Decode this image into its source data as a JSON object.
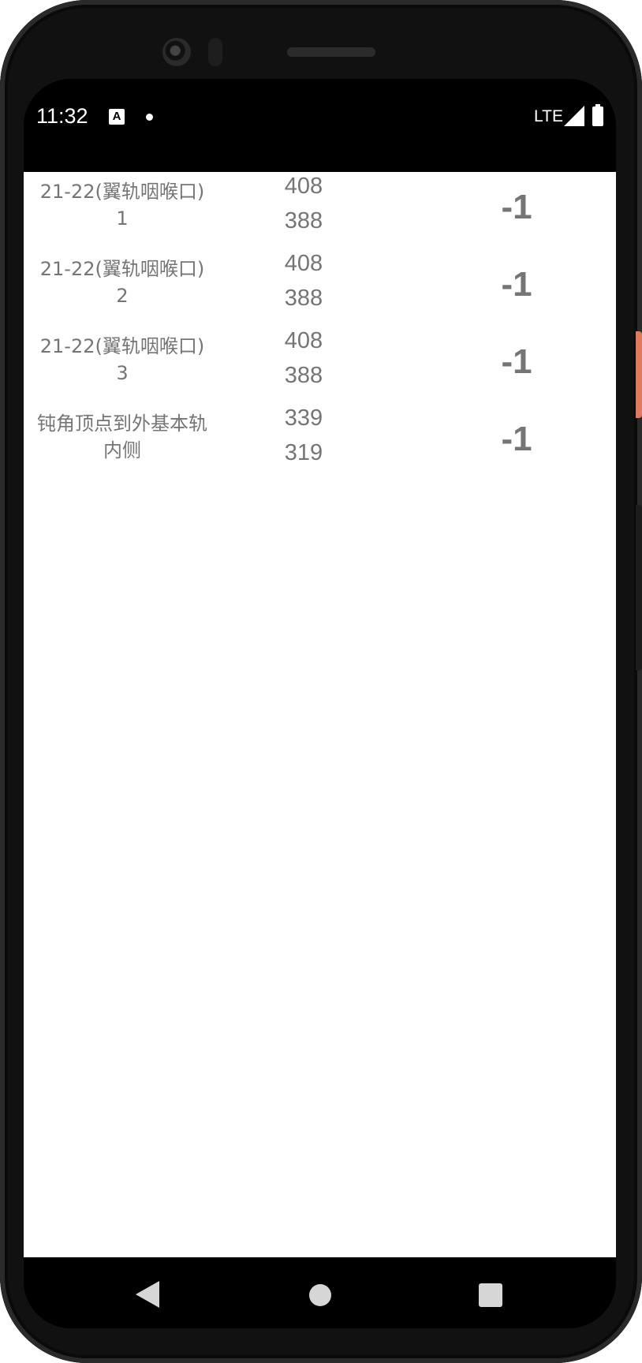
{
  "status_bar": {
    "time": "11:32",
    "notification_icon": "a-notification-icon",
    "network": "LTE",
    "signal_icon": "signal-icon",
    "battery_icon": "battery-icon"
  },
  "rows": [
    {
      "label_line1": "21-22(翼轨咽喉口)",
      "label_line2": "1",
      "value_top": "408",
      "value_bottom": "388",
      "difference": "-1"
    },
    {
      "label_line1": "21-22(翼轨咽喉口)",
      "label_line2": "2",
      "value_top": "408",
      "value_bottom": "388",
      "difference": "-1"
    },
    {
      "label_line1": "21-22(翼轨咽喉口)",
      "label_line2": "3",
      "value_top": "408",
      "value_bottom": "388",
      "difference": "-1"
    },
    {
      "label_line1": "钝角顶点到外基本轨",
      "label_line2": "内侧",
      "value_top": "339",
      "value_bottom": "319",
      "difference": "-1"
    }
  ],
  "nav_bar": {
    "back_icon": "back-triangle-icon",
    "home_icon": "home-circle-icon",
    "recent_icon": "recent-square-icon"
  }
}
